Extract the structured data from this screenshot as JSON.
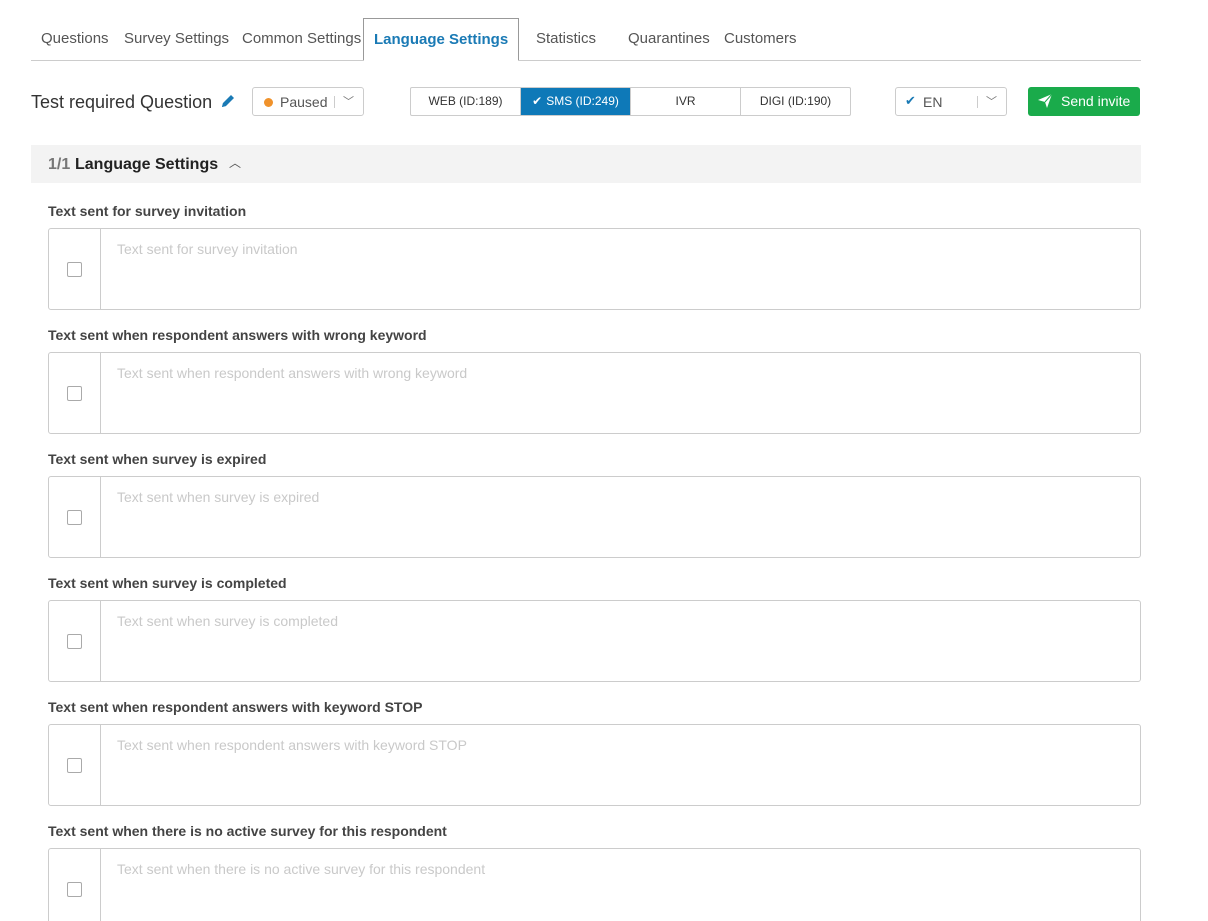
{
  "tabs": [
    {
      "label": "Questions",
      "active": false
    },
    {
      "label": "Survey Settings",
      "active": false
    },
    {
      "label": "Common Settings",
      "active": false
    },
    {
      "label": "Language Settings",
      "active": true
    },
    {
      "label": "Statistics",
      "active": false
    },
    {
      "label": "Quarantines",
      "active": false
    },
    {
      "label": "Customers",
      "active": false
    }
  ],
  "header": {
    "title": "Test required Question",
    "status": {
      "label": "Paused",
      "color": "#f0922b"
    },
    "channels": [
      {
        "label": "WEB (ID:189)",
        "active": false
      },
      {
        "label": "SMS (ID:249)",
        "active": true
      },
      {
        "label": "IVR",
        "active": false
      },
      {
        "label": "DIGI (ID:190)",
        "active": false
      }
    ],
    "language": "EN",
    "send_label": "Send invite",
    "accent_color": "#0e79b8",
    "send_color": "#1aab4b"
  },
  "section": {
    "count": "1/1",
    "title": "Language Settings"
  },
  "fields": [
    {
      "label": "Text sent for survey invitation",
      "placeholder": "Text sent for survey invitation",
      "value": ""
    },
    {
      "label": "Text sent when respondent answers with wrong keyword",
      "placeholder": "Text sent when respondent answers with wrong keyword",
      "value": ""
    },
    {
      "label": "Text sent when survey is expired",
      "placeholder": "Text sent when survey is expired",
      "value": ""
    },
    {
      "label": "Text sent when survey is completed",
      "placeholder": "Text sent when survey is completed",
      "value": ""
    },
    {
      "label": "Text sent when respondent answers with keyword STOP",
      "placeholder": "Text sent when respondent answers with keyword STOP",
      "value": ""
    },
    {
      "label": "Text sent when there is no active survey for this respondent",
      "placeholder": "Text sent when there is no active survey for this respondent",
      "value": ""
    }
  ]
}
